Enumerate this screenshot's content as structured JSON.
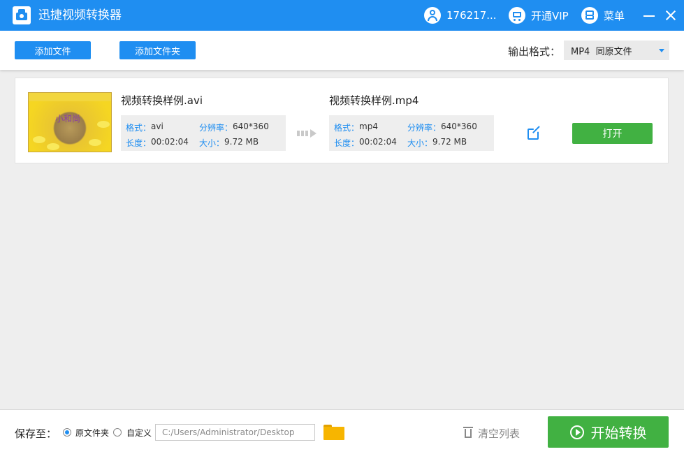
{
  "window": {
    "title": "迅捷视频转换器",
    "user_label": "176217...",
    "vip_label": "开通VIP",
    "menu_label": "菜单"
  },
  "toolbar": {
    "add_file_label": "添加文件",
    "add_folder_label": "添加文件夹",
    "output_format_label": "输出格式：",
    "output_format_value": "MP4  同原文件"
  },
  "file_item": {
    "thumbnail_text": "小和尚",
    "source": {
      "name": "视频转换样例.avi",
      "format_key": "格式：",
      "format": "avi",
      "resolution_key": "分辨率：",
      "resolution": "640*360",
      "duration_key": "长度：",
      "duration": "00:02:04",
      "size_key": "大小：",
      "size": "9.72 MB"
    },
    "target": {
      "name": "视频转换样例.mp4",
      "format_key": "格式：",
      "format": "mp4",
      "resolution_key": "分辨率：",
      "resolution": "640*360",
      "duration_key": "长度：",
      "duration": "00:02:04",
      "size_key": "大小：",
      "size": "9.72 MB"
    },
    "open_label": "打开"
  },
  "bottom": {
    "save_to_label": "保存至：",
    "option_original": "原文件夹",
    "option_custom": "自定义",
    "path_placeholder": "C:/Users/Administrator/Desktop",
    "clear_label": "清空列表",
    "start_label": "开始转换"
  },
  "colors": {
    "accent": "#1f8ef1",
    "action_green": "#41b142"
  }
}
